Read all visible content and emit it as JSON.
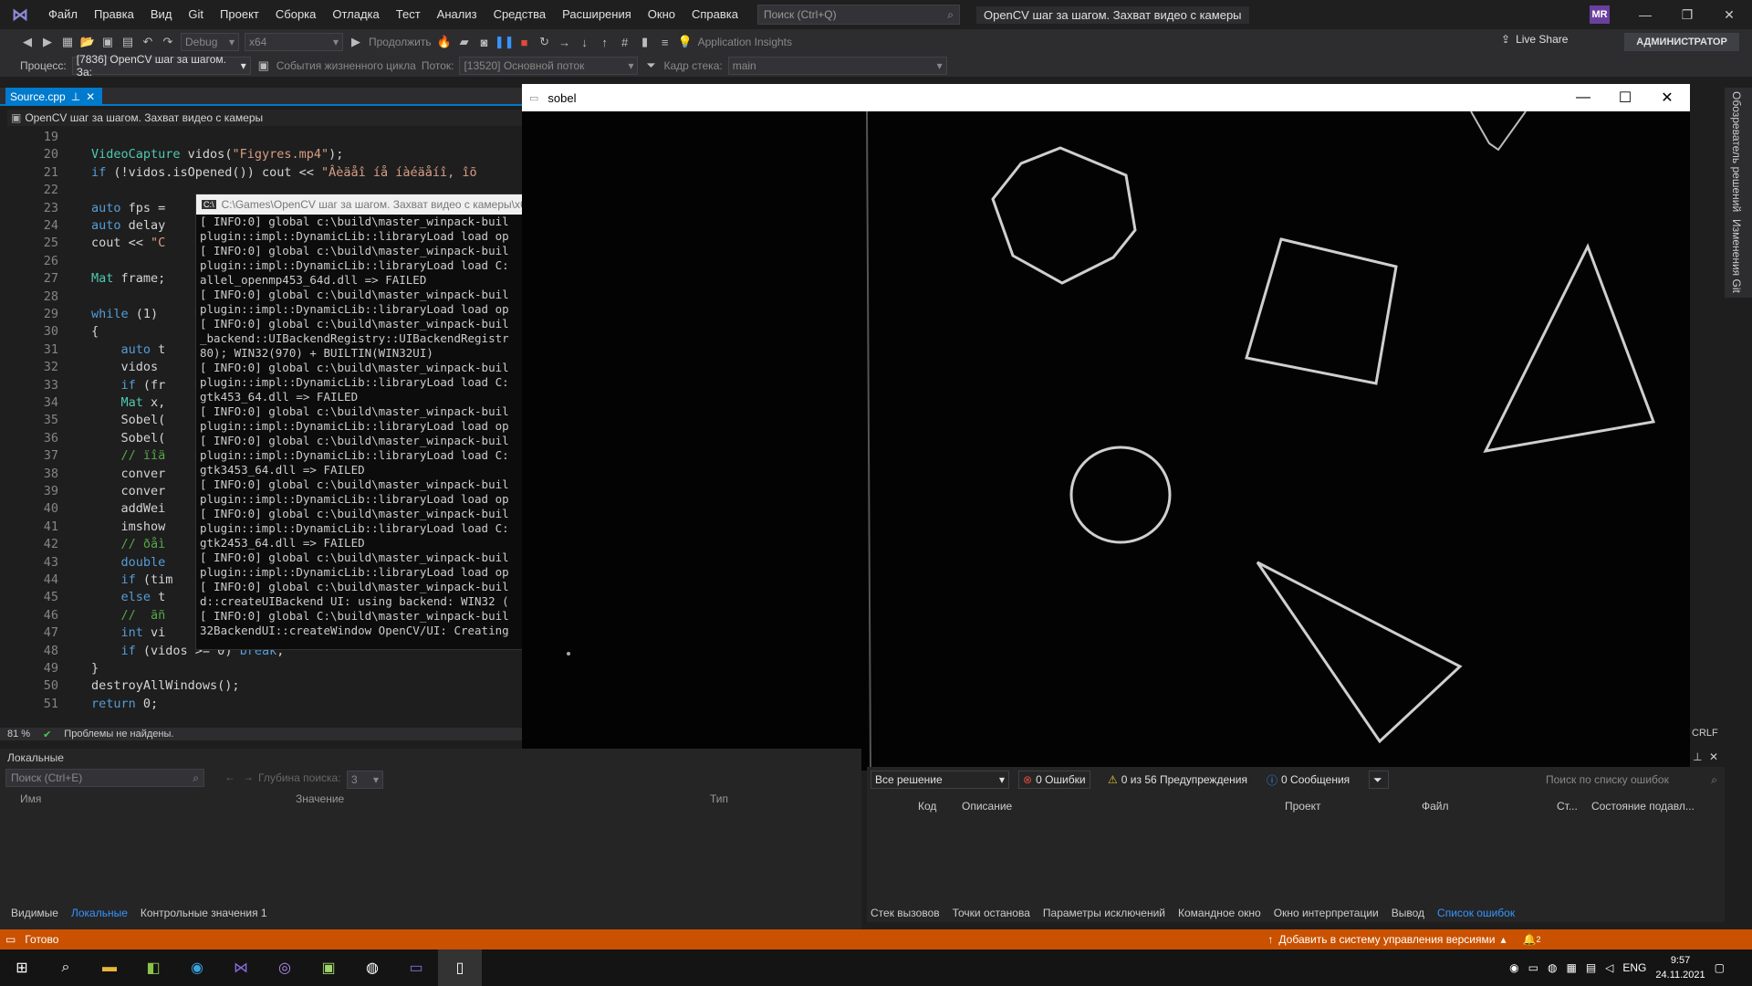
{
  "menu": [
    "Файл",
    "Правка",
    "Вид",
    "Git",
    "Проект",
    "Сборка",
    "Отладка",
    "Тест",
    "Анализ",
    "Средства",
    "Расширения",
    "Окно",
    "Справка"
  ],
  "search": {
    "placeholder": "Поиск (Ctrl+Q)"
  },
  "window_title": "OpenCV шаг за шагом. Захват видео с камеры",
  "avatar": "MR",
  "toolbar": {
    "config": "Debug",
    "platform": "x64",
    "continue": "Продолжить",
    "app_insights": "Application Insights",
    "live_share": "Live Share",
    "admin": "АДМИНИСТРАТОР"
  },
  "debugbar": {
    "process_label": "Процесс:",
    "process_value": "[7836] OpenCV шаг за шагом. За:",
    "lifecycle": "События жизненного цикла",
    "thread_label": "Поток:",
    "thread_value": "[13520] Основной поток",
    "frame_label": "Кадр стека:",
    "frame_value": "main"
  },
  "editor": {
    "tab": "Source.cpp",
    "nav": "OpenCV шаг за шагом. Захват видео с камеры",
    "zoom": "81 %",
    "problems": "Проблемы не найдены.",
    "crlf": "CRLF",
    "lines": [
      {
        "n": "19",
        "t": ""
      },
      {
        "n": "20",
        "t": "VideoCapture vidos(\"Figyres.mp4\");"
      },
      {
        "n": "21",
        "t": "if (!vidos.isOpened()) cout << \"Âèäåî íå íàéäåíî, îõ"
      },
      {
        "n": "22",
        "t": ""
      },
      {
        "n": "23",
        "t": "auto fps ="
      },
      {
        "n": "24",
        "t": "auto delay"
      },
      {
        "n": "25",
        "t": "cout << \"C"
      },
      {
        "n": "26",
        "t": ""
      },
      {
        "n": "27",
        "t": "Mat frame;"
      },
      {
        "n": "28",
        "t": ""
      },
      {
        "n": "29",
        "t": "while (1)"
      },
      {
        "n": "30",
        "t": "{"
      },
      {
        "n": "31",
        "t": "    auto t"
      },
      {
        "n": "32",
        "t": "    vidos"
      },
      {
        "n": "33",
        "t": "    if (fr"
      },
      {
        "n": "34",
        "t": "    Mat x,"
      },
      {
        "n": "35",
        "t": "    Sobel("
      },
      {
        "n": "36",
        "t": "    Sobel("
      },
      {
        "n": "37",
        "t": "    // ïîä"
      },
      {
        "n": "38",
        "t": "    conver"
      },
      {
        "n": "39",
        "t": "    conver"
      },
      {
        "n": "40",
        "t": "    addWei"
      },
      {
        "n": "41",
        "t": "    imshow"
      },
      {
        "n": "42",
        "t": "    // ðåì"
      },
      {
        "n": "43",
        "t": "    double"
      },
      {
        "n": "44",
        "t": "    if (tim"
      },
      {
        "n": "45",
        "t": "    else t"
      },
      {
        "n": "46",
        "t": "    //  ãñ"
      },
      {
        "n": "47",
        "t": "    int vi"
      },
      {
        "n": "48",
        "t": "    if (vidos >= 0) break;"
      },
      {
        "n": "49",
        "t": "}"
      },
      {
        "n": "50",
        "t": "destroyAllWindows();"
      },
      {
        "n": "51",
        "t": "return 0;"
      }
    ]
  },
  "console": {
    "title": "C:\\Games\\OpenCV шаг за шагом. Захват видео с камеры\\x64",
    "lines": [
      "[ INFO:0] global c:\\build\\master_winpack-buil",
      "plugin::impl::DynamicLib::libraryLoad load op",
      "[ INFO:0] global c:\\build\\master_winpack-buil",
      "plugin::impl::DynamicLib::libraryLoad load C:",
      "allel_openmp453_64d.dll => FAILED",
      "[ INFO:0] global c:\\build\\master_winpack-buil",
      "plugin::impl::DynamicLib::libraryLoad load op",
      "[ INFO:0] global c:\\build\\master_winpack-buil",
      "_backend::UIBackendRegistry::UIBackendRegistr",
      "80); WIN32(970) + BUILTIN(WIN32UI)",
      "[ INFO:0] global c:\\build\\master_winpack-buil",
      "plugin::impl::DynamicLib::libraryLoad load C:",
      "gtk453_64.dll => FAILED",
      "[ INFO:0] global c:\\build\\master_winpack-buil",
      "plugin::impl::DynamicLib::libraryLoad load op",
      "[ INFO:0] global c:\\build\\master_winpack-buil",
      "plugin::impl::DynamicLib::libraryLoad load C:",
      "gtk3453_64.dll => FAILED",
      "[ INFO:0] global c:\\build\\master_winpack-buil",
      "plugin::impl::DynamicLib::libraryLoad load op",
      "[ INFO:0] global c:\\build\\master_winpack-buil",
      "plugin::impl::DynamicLib::libraryLoad load C:",
      "gtk2453_64.dll => FAILED",
      "[ INFO:0] global c:\\build\\master_winpack-buil",
      "plugin::impl::DynamicLib::libraryLoad load op",
      "[ INFO:0] global c:\\build\\master_winpack-buil",
      "d::createUIBackend UI: using backend: WIN32 (",
      "[ INFO:0] global C:\\build\\master_winpack-buil",
      "32BackendUI::createWindow OpenCV/UI: Creating"
    ]
  },
  "sobel": {
    "title": "sobel"
  },
  "right_sidebar": [
    "Обозреватель решений",
    "Изменения Git"
  ],
  "locals": {
    "title": "Локальные",
    "search_placeholder": "Поиск (Ctrl+E)",
    "depth_label": "Глубина поиска:",
    "depth_value": "3",
    "cols": [
      "Имя",
      "Значение",
      "Тип"
    ],
    "tabs": [
      "Видимые",
      "Локальные",
      "Контрольные значения 1"
    ]
  },
  "errorlist": {
    "scope": "Все решение",
    "errors": "0 Ошибки",
    "warnings": "0 из 56 Предупреждения",
    "messages": "0 Сообщения",
    "search_placeholder": "Поиск по списку ошибок",
    "cols": [
      "Код",
      "Описание",
      "Проект",
      "Файл",
      "Ст...",
      "Состояние подавл..."
    ],
    "tabs": [
      "Стек вызовов",
      "Точки останова",
      "Параметры исключений",
      "Командное окно",
      "Окно интерпретации",
      "Вывод",
      "Список ошибок"
    ]
  },
  "statusbar": {
    "ready": "Готово",
    "vcs": "Добавить в систему управления версиями",
    "notif": "2"
  },
  "taskbar": {
    "lang": "ENG",
    "time": "9:57",
    "date": "24.11.2021"
  },
  "colors": {
    "accent": "#007acc",
    "status": "#ca5100"
  }
}
